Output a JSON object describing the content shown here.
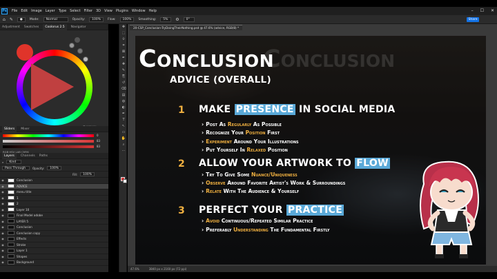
{
  "menubar": {
    "logo": "Ps",
    "items": [
      "File",
      "Edit",
      "Image",
      "Layer",
      "Type",
      "Select",
      "Filter",
      "3D",
      "View",
      "Plugins",
      "Window",
      "Help"
    ]
  },
  "options": {
    "mode_label": "Mode:",
    "mode_value": "Normal",
    "opacity_label": "Opacity:",
    "opacity_value": "100%",
    "flow_label": "Flow:",
    "flow_value": "100%",
    "smoothing_label": "Smoothing:",
    "smoothing_value": "5%",
    "angle_value": "0°",
    "share": "Share"
  },
  "panels": {
    "color_tabs": [
      "Adjustment",
      "Swatches",
      "Coolorus 2.5",
      "Navigator"
    ],
    "slider_tabs": [
      "Sliders",
      "Mixer"
    ],
    "slider_values": [
      "0",
      "83",
      "83"
    ],
    "mode_text": "RGB  HSV  LAB  CMYK",
    "layers_tabs": [
      "Layers",
      "Channels",
      "Paths"
    ],
    "layers_kind": "Kind",
    "blend_mode": "Pass Through",
    "opacity_label": "Opacity:",
    "opacity": "100%",
    "fill_label": "Fill:",
    "fill": "100%"
  },
  "layers": [
    {
      "name": "Conclusion",
      "selected": false
    },
    {
      "name": "ADVICE",
      "selected": true
    },
    {
      "name": "menu title",
      "selected": false
    },
    {
      "name": "1",
      "selected": false
    },
    {
      "name": "2",
      "selected": false
    },
    {
      "name": "Layer 10",
      "selected": false
    },
    {
      "name": "Final Model adobe",
      "selected": false
    },
    {
      "name": "LAYER 5",
      "selected": false
    },
    {
      "name": "Conclusion",
      "selected": false
    },
    {
      "name": "Conclusion copy",
      "selected": false
    },
    {
      "name": "Effects",
      "selected": false
    },
    {
      "name": "Stroke",
      "selected": false
    },
    {
      "name": "Layer 1",
      "selected": false
    },
    {
      "name": "Shapes",
      "selected": false
    },
    {
      "name": "Background",
      "selected": false
    }
  ],
  "document": {
    "tab": "20-CSP_Conclusion-TryDoingTheirNothing.psd @ 47.6% (advice, RGB/8) *",
    "zoom": "47.6%",
    "dimensions": "3840 px x 2160 px (72 ppi)"
  },
  "slide": {
    "title": "Conclusion",
    "ghost": "Conclusion",
    "subtitle": "ADVICE (OVERALL)",
    "sections": [
      {
        "num": "1",
        "pre": "MAKE ",
        "hl": "PRESENCE",
        "post": " IN SOCIAL MEDIA",
        "bullets": [
          {
            "a": "Post As ",
            "k": "Regularly",
            "b": " As Possible"
          },
          {
            "a": "Recognize Your ",
            "k": "Position",
            "b": " First"
          },
          {
            "a": "",
            "k": "Experiment",
            "b": " Around Your Illustrations"
          },
          {
            "a": "Put Yourself In ",
            "k": "Relaxed",
            "b": " Position"
          }
        ]
      },
      {
        "num": "2",
        "pre": "ALLOW YOUR ARTWORK TO ",
        "hl": "FLOW",
        "post": "",
        "bullets": [
          {
            "a": "Try To Give Some ",
            "k": "Nuance/Uniqueness",
            "b": ""
          },
          {
            "a": "",
            "k": "Observe",
            "b": " Around Favorite Artist's Work & Surroundings"
          },
          {
            "a": "",
            "k": "Relate",
            "b": " With The Audience & Yourself"
          }
        ]
      },
      {
        "num": "3",
        "pre": "PERFECT YOUR ",
        "hl": "PRACTICE",
        "post": "",
        "bullets": [
          {
            "a": "",
            "k": "Avoid",
            "b": " Continuous/Repeated Similar Practice"
          },
          {
            "a": "Preferably ",
            "k": "Understanding",
            "b": " The Fundamental Firstly"
          }
        ]
      }
    ]
  },
  "colors": {
    "accent_blue": "#5aa9d8",
    "accent_orange": "#f0b040",
    "foreground": "#d93636",
    "share_button": "#1473e6"
  }
}
